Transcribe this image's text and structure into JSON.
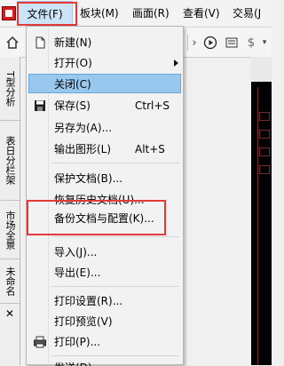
{
  "menubar": {
    "items": [
      "文件(F)",
      "板块(M)",
      "画面(R)",
      "查看(V)",
      "交易(J"
    ]
  },
  "toolbar": {
    "icons": [
      "home-icon",
      "back-icon",
      "forward-icon",
      "play-icon",
      "list-icon",
      "dollar-icon"
    ]
  },
  "sidetabs": {
    "items": [
      "T型分析",
      "表日分栏架",
      "市场全景",
      "未命名"
    ],
    "close": "✕"
  },
  "dropdown": {
    "items": [
      {
        "label": "新建(N)",
        "icon": "new-document-icon"
      },
      {
        "label": "打开(O)",
        "submenu": true
      },
      {
        "label": "关闭(C)",
        "active": true
      },
      {
        "label": "保存(S)",
        "shortcut": "Ctrl+S",
        "icon": "save-icon"
      },
      {
        "label": "另存为(A)..."
      },
      {
        "label": "输出图形(L)",
        "shortcut": "Alt+S"
      },
      {
        "label": "保护文档(B)..."
      },
      {
        "label": "恢复历史文档(U)..."
      },
      {
        "label": "备份文档与配置(K)..."
      },
      {
        "label": "导入(J)..."
      },
      {
        "label": "导出(E)..."
      },
      {
        "label": "打印设置(R)..."
      },
      {
        "label": "打印预览(V)"
      },
      {
        "label": "打印(P)...",
        "icon": "printer-icon"
      },
      {
        "label": "发送(D)..."
      }
    ]
  },
  "colors": {
    "highlight_box": "#e53935",
    "active_item": "#99c8ee",
    "menu_hover": "#cce4f7"
  }
}
